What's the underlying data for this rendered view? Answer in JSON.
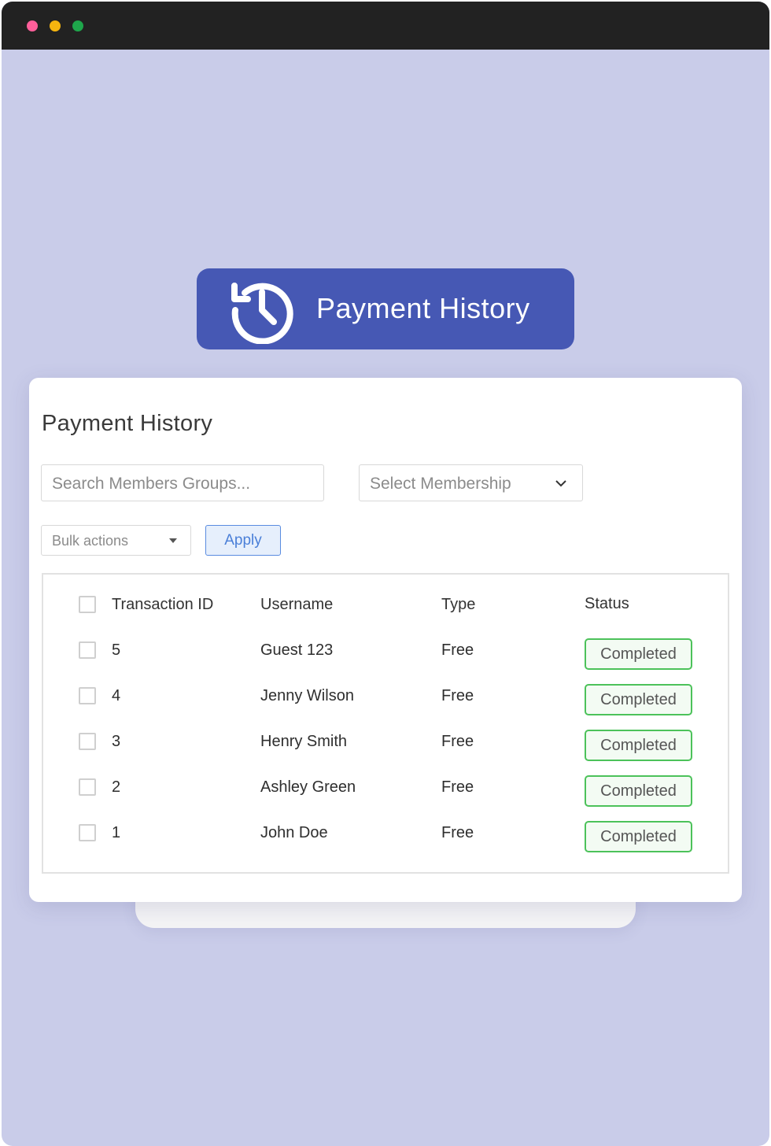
{
  "hero": {
    "title": "Payment History",
    "icon": "history-icon",
    "color": "#4658b4"
  },
  "card": {
    "title": "Payment History",
    "search": {
      "placeholder": "Search Members Groups..."
    },
    "membership_select": {
      "value": "Select Membership"
    },
    "bulk_actions": {
      "value": "Bulk actions"
    },
    "apply_label": "Apply"
  },
  "table": {
    "columns": [
      "Transaction ID",
      "Username",
      "Type",
      "Status"
    ],
    "rows": [
      {
        "id": "5",
        "username": "Guest 123",
        "type": "Free",
        "status": "Completed"
      },
      {
        "id": "4",
        "username": "Jenny Wilson",
        "type": "Free",
        "status": "Completed"
      },
      {
        "id": "3",
        "username": "Henry Smith",
        "type": "Free",
        "status": "Completed"
      },
      {
        "id": "2",
        "username": "Ashley Green",
        "type": "Free",
        "status": "Completed"
      },
      {
        "id": "1",
        "username": "John Doe",
        "type": "Free",
        "status": "Completed"
      }
    ]
  },
  "colors": {
    "background": "#c9cce9",
    "status_completed": "#4cc25a",
    "apply_accent": "#4a7fd8"
  }
}
